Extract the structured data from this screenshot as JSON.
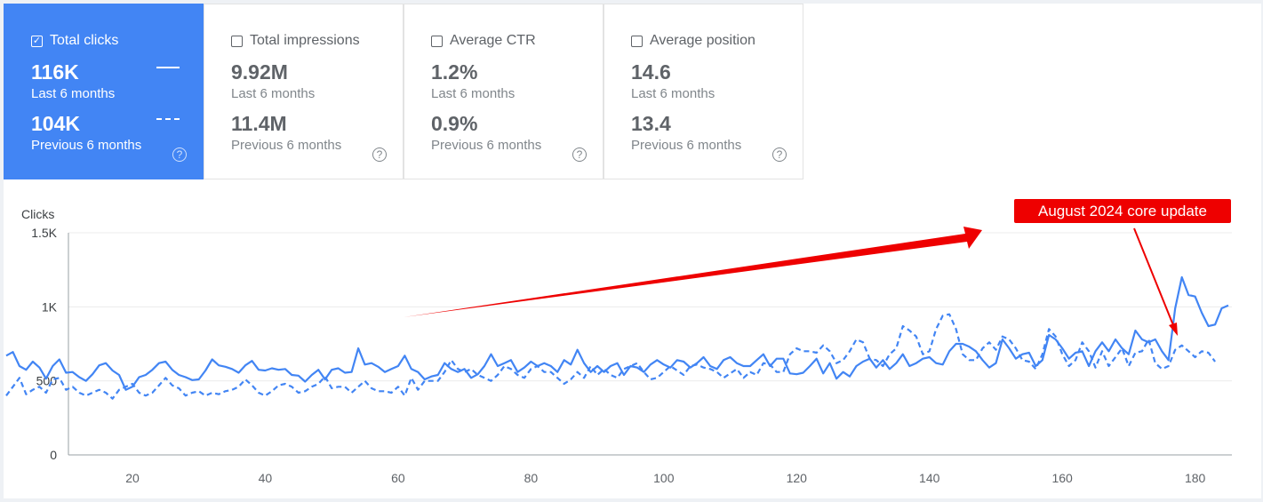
{
  "metrics": [
    {
      "label": "Total clicks",
      "current": "116K",
      "current_period": "Last 6 months",
      "previous": "104K",
      "previous_period": "Previous 6 months",
      "checked": true
    },
    {
      "label": "Total impressions",
      "current": "9.92M",
      "current_period": "Last 6 months",
      "previous": "11.4M",
      "previous_period": "Previous 6 months",
      "checked": false
    },
    {
      "label": "Average CTR",
      "current": "1.2%",
      "current_period": "Last 6 months",
      "previous": "0.9%",
      "previous_period": "Previous 6 months",
      "checked": false
    },
    {
      "label": "Average position",
      "current": "14.6",
      "current_period": "Last 6 months",
      "previous": "13.4",
      "previous_period": "Previous 6 months",
      "checked": false
    }
  ],
  "colors": {
    "accent": "#4285f4",
    "annotation": "#ee0000"
  },
  "icons": {
    "checked": "check-box-icon",
    "unchecked": "empty-checkbox-icon",
    "help": "help-circle-icon"
  },
  "chart_data": {
    "type": "line",
    "ylabel": "Clicks",
    "ylim": [
      0,
      1500
    ],
    "yticks": [
      "0",
      "500",
      "1K",
      "1.5K"
    ],
    "xlim": [
      1,
      185
    ],
    "xticks": [
      "20",
      "40",
      "60",
      "80",
      "100",
      "120",
      "140",
      "160",
      "180"
    ],
    "grid": true,
    "series": [
      {
        "style": "solid",
        "x_start": 1,
        "values": [
          670,
          695,
          600,
          575,
          630,
          590,
          515,
          600,
          645,
          555,
          560,
          525,
          500,
          545,
          605,
          620,
          570,
          540,
          440,
          460,
          525,
          540,
          575,
          620,
          630,
          575,
          540,
          525,
          505,
          510,
          570,
          645,
          605,
          595,
          580,
          555,
          605,
          635,
          575,
          570,
          585,
          575,
          580,
          540,
          535,
          495,
          540,
          575,
          510,
          575,
          585,
          555,
          560,
          720,
          610,
          620,
          595,
          560,
          580,
          600,
          670,
          580,
          560,
          510,
          530,
          540,
          620,
          580,
          560,
          580,
          520,
          545,
          600,
          680,
          600,
          620,
          640,
          560,
          590,
          630,
          600,
          620,
          600,
          560,
          640,
          610,
          710,
          620,
          560,
          600,
          560,
          600,
          620,
          540,
          600,
          590,
          560,
          610,
          640,
          610,
          590,
          640,
          630,
          590,
          620,
          660,
          600,
          580,
          640,
          660,
          620,
          600,
          600,
          640,
          680,
          600,
          650,
          650,
          550,
          545,
          555,
          600,
          650,
          550,
          620,
          515,
          560,
          530,
          600,
          630,
          650,
          590,
          640,
          580,
          620,
          680,
          600,
          620,
          650,
          660,
          620,
          610,
          700,
          750,
          750,
          730,
          700,
          640,
          590,
          620,
          780,
          720,
          650,
          680,
          690,
          600,
          640,
          810,
          780,
          720,
          650,
          690,
          700,
          600,
          700,
          760,
          700,
          780,
          720,
          680,
          840,
          780,
          760,
          780,
          700,
          640,
          990,
          1200,
          1080,
          1070,
          960,
          870,
          880,
          990,
          1010
        ]
      },
      {
        "style": "dashed",
        "x_start": 1,
        "values": [
          400,
          460,
          520,
          410,
          440,
          460,
          420,
          510,
          520,
          440,
          460,
          420,
          400,
          420,
          440,
          420,
          380,
          440,
          460,
          480,
          420,
          400,
          420,
          470,
          520,
          470,
          450,
          400,
          420,
          430,
          400,
          420,
          410,
          430,
          440,
          460,
          510,
          470,
          420,
          400,
          430,
          470,
          480,
          460,
          420,
          430,
          460,
          480,
          530,
          450,
          460,
          460,
          420,
          460,
          500,
          450,
          430,
          430,
          420,
          460,
          400,
          520,
          440,
          500,
          500,
          500,
          560,
          640,
          580,
          560,
          580,
          540,
          520,
          500,
          540,
          600,
          580,
          540,
          520,
          580,
          600,
          560,
          560,
          520,
          480,
          510,
          560,
          520,
          600,
          540,
          580,
          540,
          520,
          580,
          600,
          620,
          560,
          510,
          520,
          560,
          600,
          570,
          540,
          600,
          610,
          590,
          580,
          560,
          520,
          550,
          580,
          520,
          560,
          540,
          620,
          610,
          560,
          560,
          680,
          720,
          700,
          700,
          690,
          740,
          700,
          620,
          640,
          700,
          780,
          760,
          650,
          640,
          600,
          680,
          720,
          870,
          840,
          800,
          680,
          700,
          850,
          940,
          950,
          850,
          680,
          640,
          640,
          720,
          760,
          710,
          800,
          780,
          720,
          640,
          630,
          580,
          680,
          850,
          800,
          680,
          600,
          640,
          760,
          700,
          590,
          700,
          600,
          660,
          720,
          600,
          690,
          700,
          780,
          620,
          580,
          600,
          710,
          740,
          700,
          660,
          700,
          690,
          630
        ]
      }
    ],
    "annotation": {
      "text": "August 2024 core update"
    }
  }
}
